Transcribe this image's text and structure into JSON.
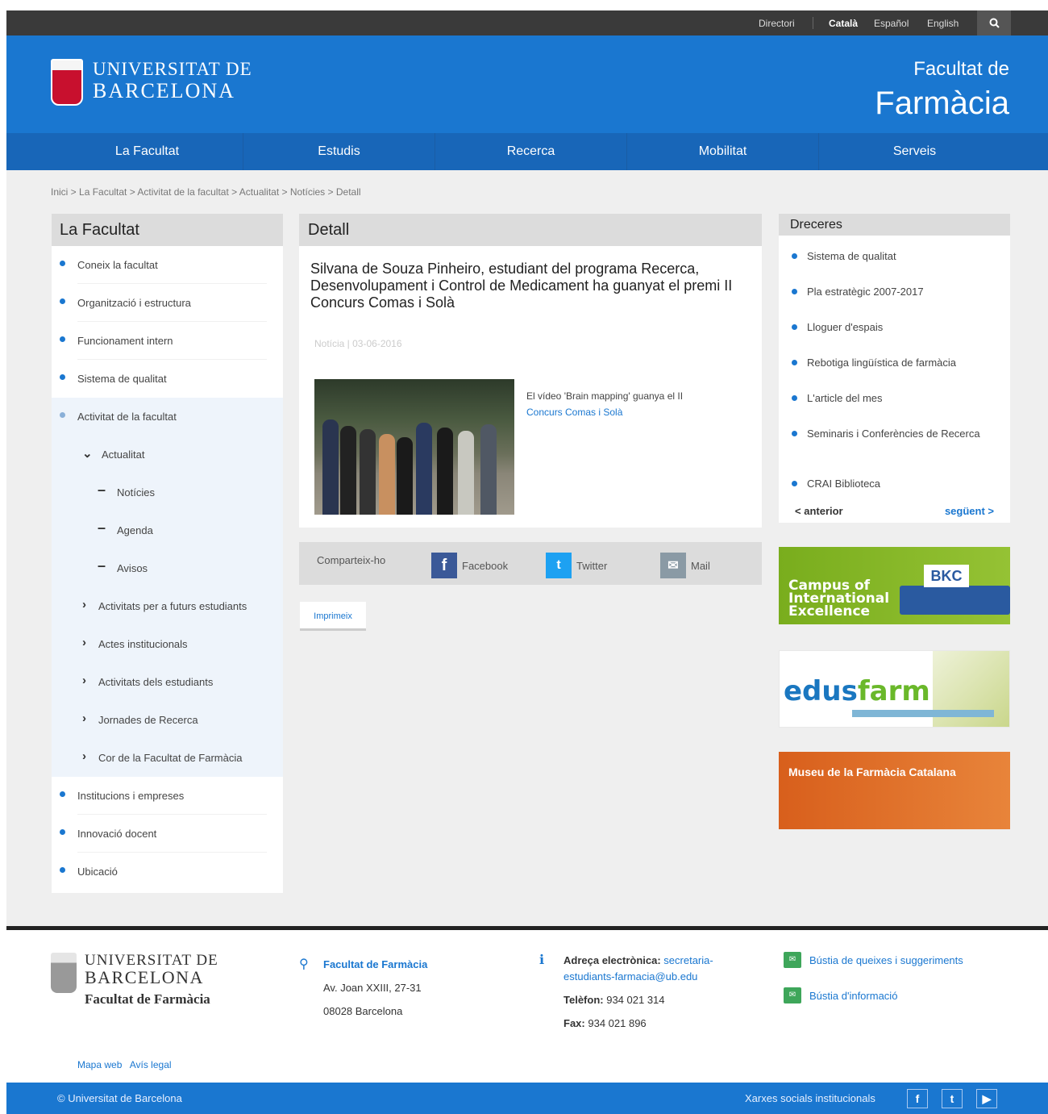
{
  "topbar": {
    "directori": "Directori",
    "lang_ca": "Català",
    "lang_es": "Español",
    "lang_en": "English"
  },
  "header": {
    "uni_line1": "UNIVERSITAT DE",
    "uni_line2": "BARCELONA",
    "faculty_line1": "Facultat de",
    "faculty_line2": "Farmàcia"
  },
  "nav": [
    "La Facultat",
    "Estudis",
    "Recerca",
    "Mobilitat",
    "Serveis"
  ],
  "breadcrumb": "Inici > La Facultat > Activitat de la facultat > Actualitat > Notícies > Detall",
  "left": {
    "title": "La Facultat",
    "items": [
      "Coneix la facultat",
      "Organització i estructura",
      "Funcionament intern",
      "Sistema de qualitat",
      "Activitat de la facultat",
      "Actualitat",
      "Notícies",
      "Agenda",
      "Avisos",
      "Activitats per a futurs estudiants",
      "Actes institucionals",
      "Activitats dels estudiants",
      "Jornades de Recerca",
      "Cor de la Facultat de Farmàcia",
      "Institucions i empreses",
      "Innovació docent",
      "Ubicació"
    ]
  },
  "article": {
    "section": "Detall",
    "title": "Silvana de Souza Pinheiro, estudiant del programa Recerca, Desenvolupament i Control de Medicament ha guanyat el premi II Concurs Comas i Solà",
    "meta": "Notícia | 03-06-2016",
    "caption_text": "El vídeo 'Brain mapping' guanya el II",
    "caption_link": "Concurs Comas i Solà"
  },
  "share": {
    "label": "Comparteix-ho",
    "facebook": "Facebook",
    "twitter": "Twitter",
    "mail": "Mail"
  },
  "print_label": "Imprimeix",
  "shortcuts": {
    "title": "Dreceres",
    "items": [
      "Sistema de qualitat",
      "Pla estratègic 2007-2017",
      "Lloguer d'espais",
      "Rebotiga lingüística de farmàcia",
      "L'article del mes",
      "Seminaris i Conferències de Recerca",
      "CRAI Biblioteca"
    ],
    "prev": "anterior",
    "next": "següent"
  },
  "banners": {
    "bkc_text": "Campus of International Excellence",
    "bkc_logo": "BKC",
    "edusfarm_a": "edus",
    "edusfarm_b": "farm",
    "museu": "Museu de la Farmàcia Catalana"
  },
  "footer": {
    "logo_line1": "UNIVERSITAT DE",
    "logo_line2": "BARCELONA",
    "logo_line3": "Facultat de Farmàcia",
    "address_title": "Facultat de Farmàcia",
    "address_line1": "Av. Joan XXIII, 27-31",
    "address_line2": "08028 Barcelona",
    "email_label": "Adreça electrònica:",
    "email": "secretaria-estudiants-farmacia@ub.edu",
    "phone_label": "Telèfon:",
    "phone": "934 021 314",
    "fax_label": "Fax:",
    "fax": "934 021 896",
    "link1": "Bústia de queixes i suggeriments",
    "link2": "Bústia d'informació",
    "mapa": "Mapa web",
    "avis": "Avís legal",
    "copyright": "© Universitat de Barcelona",
    "social_label": "Xarxes socials institucionals"
  },
  "colors": {
    "brand_blue": "#1a77d0",
    "nav_blue": "#1866b8",
    "topbar": "#3a3a3a"
  }
}
